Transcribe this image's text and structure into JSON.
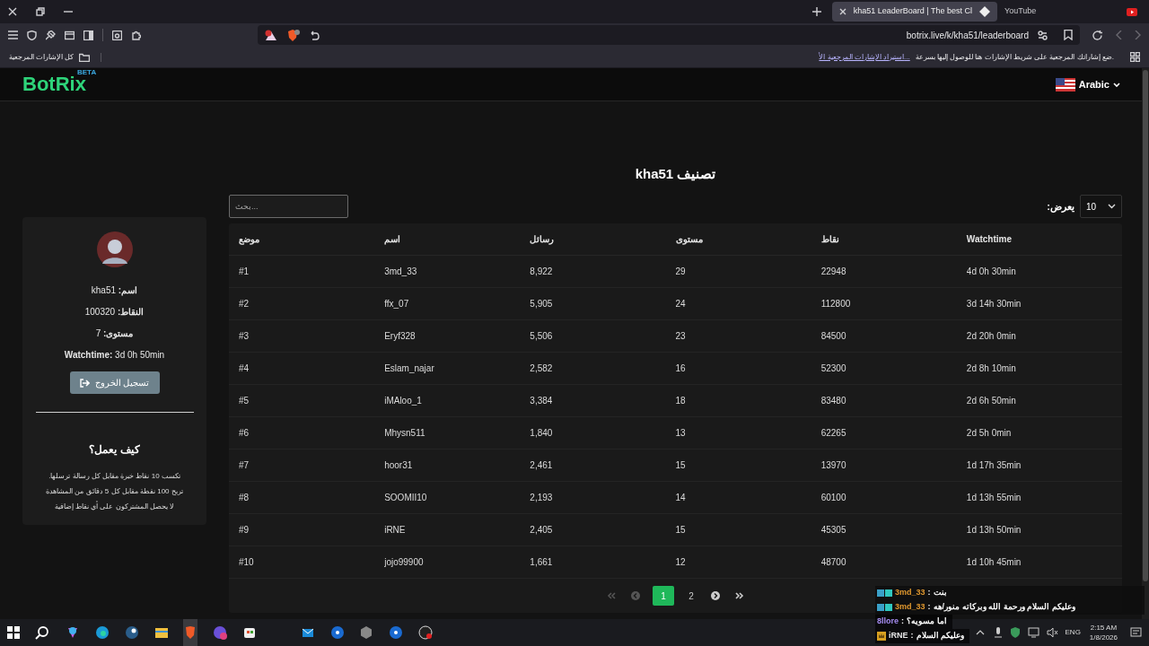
{
  "browser": {
    "tabs": [
      {
        "title": "kha51 LeaderBoard | The best Cl",
        "selected": true
      },
      {
        "title": "YouTube",
        "selected": false
      }
    ],
    "address": "botrix.live/k/kha51/leaderboard",
    "bookmarks": {
      "folder": "كل الإشارات المرجعية",
      "hint": "ضع إشاراتك المرجعية على شريط الإشارات هنا للوصول إليها بسرعة.",
      "import_link": "استيراد الإشارات المرجعية الأ..."
    }
  },
  "header": {
    "logo": "BotRix",
    "logo_badge": "BETA",
    "language": "Arabic"
  },
  "profile": {
    "lines": [
      "**اسم:** kha51",
      "**النقاط:** 100320",
      "**مستوى:** 7",
      "**Watchtime:** 3d 0h 50min"
    ],
    "logout": "تسجيل الخروج",
    "how_title": "كيف يعمل؟",
    "how_lines": [
      "تكسب 10 نقاط خبرة مقابل كل رسالة ترسلها.",
      "تربح 100 نقطة مقابل كل 5 دقائق من المشاهدة",
      "لا يحصل المشتركون على أي نقاط إضافية"
    ]
  },
  "leaderboard": {
    "title": "تصنيف kha51",
    "search_placeholder": "بحث...",
    "show_label": "يعرض:",
    "page_size": "10",
    "columns": [
      "موضع",
      "اسم",
      "رسائل",
      "مستوى",
      "نقاط",
      "Watchtime"
    ],
    "rows": [
      [
        "#1",
        "3md_33",
        "8,922",
        "29",
        "22948",
        "4d 0h 30min"
      ],
      [
        "#2",
        "ffx_07",
        "5,905",
        "24",
        "112800",
        "3d 14h 30min"
      ],
      [
        "#3",
        "Eryf328",
        "5,506",
        "23",
        "84500",
        "2d 20h 0min"
      ],
      [
        "#4",
        "Eslam_najar",
        "2,582",
        "16",
        "52300",
        "2d 8h 10min"
      ],
      [
        "#5",
        "iMAloo_1",
        "3,384",
        "18",
        "83480",
        "2d 6h 50min"
      ],
      [
        "#6",
        "Mhysn511",
        "1,840",
        "13",
        "62265",
        "2d 5h 0min"
      ],
      [
        "#7",
        "hoor31",
        "2,461",
        "15",
        "13970",
        "1d 17h 35min"
      ],
      [
        "#8",
        "SOOMII10",
        "2,193",
        "14",
        "60100",
        "1d 13h 55min"
      ],
      [
        "#9",
        "iRNE",
        "2,405",
        "15",
        "45305",
        "1d 13h 50min"
      ],
      [
        "#10",
        "jojo99900",
        "1,661",
        "12",
        "48700",
        "1d 10h 45min"
      ]
    ]
  },
  "pagination": [
    {
      "kind": "first",
      "disabled": true,
      "selected": false
    },
    {
      "kind": "prev",
      "disabled": true,
      "selected": false
    },
    {
      "kind": "page",
      "label": "1",
      "selected": true
    },
    {
      "kind": "page",
      "label": "2",
      "selected": false
    },
    {
      "kind": "next",
      "disabled": false,
      "selected": false
    },
    {
      "kind": "last",
      "disabled": false,
      "selected": false
    }
  ],
  "chat": [
    {
      "kind": "subscriber",
      "user": "3md_33",
      "color": "#e0982e",
      "separator": ":",
      "message": "بنت"
    },
    {
      "kind": "subscriber",
      "user": "3md_33",
      "color": "#e0982e",
      "separator": ":",
      "message": "وعليكم السلام ورحمة الله وبركاته منور/هه"
    },
    {
      "kind": "plain",
      "user": "8llore",
      "color": "#a58cf0",
      "separator": ":",
      "message": "اما مسويه؟"
    },
    {
      "kind": "crowned",
      "user": "iRNE",
      "color": "#e8e8e8",
      "separator": ":",
      "message": "وعليكم السلام"
    }
  ],
  "taskbar": {
    "language": "ENG",
    "time": "2:15 AM",
    "date": "1/8/2026"
  }
}
